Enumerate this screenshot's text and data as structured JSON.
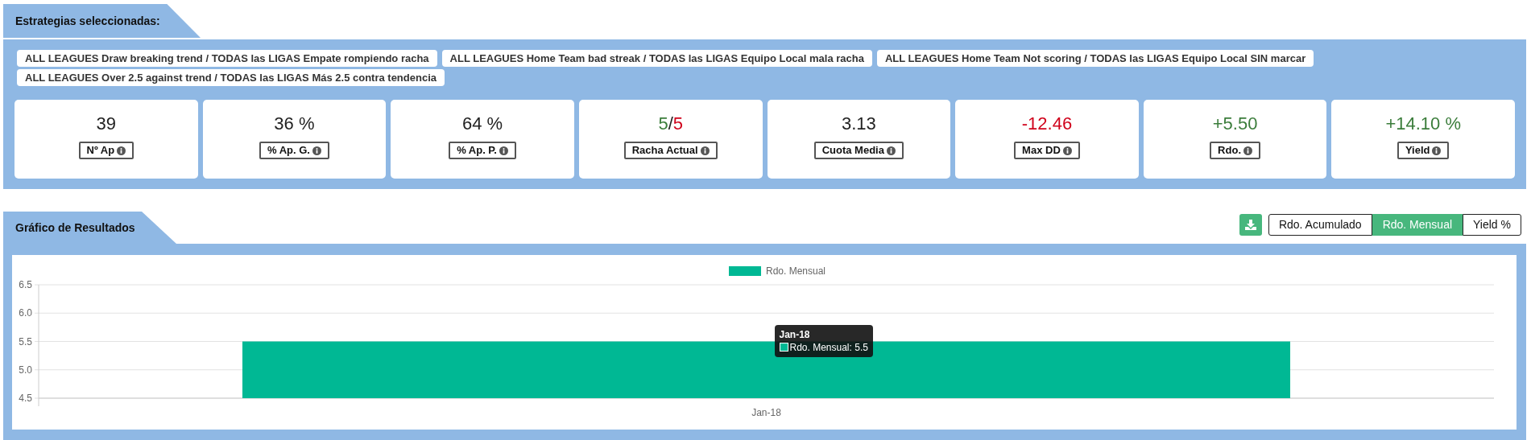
{
  "strategies_section": {
    "title": "Estrategias seleccionadas:",
    "tags": [
      "ALL LEAGUES Draw breaking trend / TODAS las LIGAS Empate rompiendo racha",
      "ALL LEAGUES Home Team bad streak / TODAS las LIGAS Equipo Local mala racha",
      "ALL LEAGUES Home Team Not scoring / TODAS las LIGAS Equipo Local SIN marcar",
      "ALL LEAGUES Over 2.5 against trend / TODAS las LIGAS Más 2.5 contra tendencia"
    ],
    "stats": [
      {
        "value": [
          {
            "text": "39",
            "color": "#222222"
          }
        ],
        "label": "Nº Ap"
      },
      {
        "value": [
          {
            "text": "36 %",
            "color": "#222222"
          }
        ],
        "label": "% Ap. G."
      },
      {
        "value": [
          {
            "text": "64 %",
            "color": "#222222"
          }
        ],
        "label": "% Ap. P."
      },
      {
        "value": [
          {
            "text": "5",
            "color": "#3b7d3b"
          },
          {
            "text": "/",
            "color": "#222222"
          },
          {
            "text": "5",
            "color": "#d0021b"
          }
        ],
        "label": "Racha Actual"
      },
      {
        "value": [
          {
            "text": "3.13",
            "color": "#222222"
          }
        ],
        "label": "Cuota Media"
      },
      {
        "value": [
          {
            "text": "-12.46",
            "color": "#d0021b"
          }
        ],
        "label": "Max DD"
      },
      {
        "value": [
          {
            "text": "+5.50",
            "color": "#3b7d3b"
          }
        ],
        "label": "Rdo."
      },
      {
        "value": [
          {
            "text": "+14.10 %",
            "color": "#3b7d3b"
          }
        ],
        "label": "Yield"
      }
    ]
  },
  "results_section": {
    "title": "Gráfico de Resultados",
    "view_buttons": [
      {
        "label": "Rdo. Acumulado",
        "selected": false
      },
      {
        "label": "Rdo. Mensual",
        "selected": true
      },
      {
        "label": "Yield %",
        "selected": false
      }
    ],
    "chart_data": {
      "type": "bar",
      "categories": [
        "Jan-18"
      ],
      "series": [
        {
          "name": "Rdo. Mensual",
          "color": "#00b894",
          "values": [
            5.5
          ]
        }
      ],
      "ylim": [
        4.5,
        6.5
      ],
      "grid": true,
      "yticks": [
        {
          "value": 4.5,
          "label": "4.5"
        },
        {
          "value": 5,
          "label": "5.0"
        },
        {
          "value": 5.5,
          "label": "5.5"
        },
        {
          "value": 6,
          "label": "6.0"
        },
        {
          "value": 6.5,
          "label": "6.5"
        }
      ]
    },
    "tooltip": {
      "title": "Jan-18",
      "text": "Rdo. Mensual: 5.5"
    }
  }
}
